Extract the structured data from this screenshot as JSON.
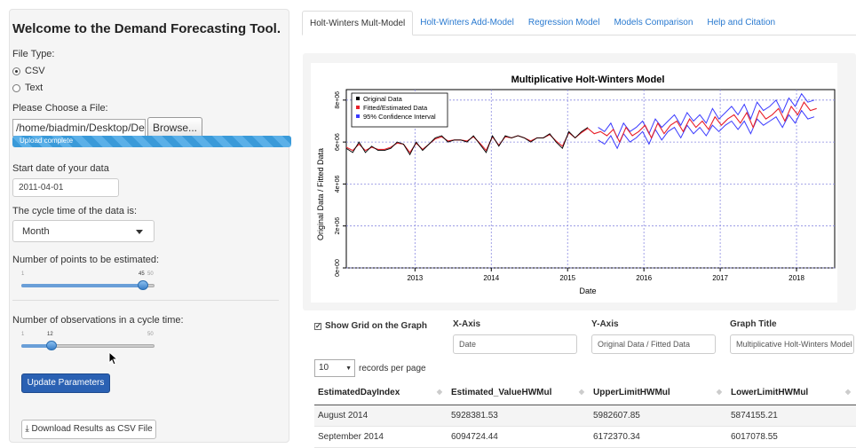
{
  "sidebar": {
    "title": "Welcome to the Demand Forecasting Tool.",
    "file_type_label": "File Type:",
    "file_type_options": [
      "CSV",
      "Text"
    ],
    "file_type_selected": "CSV",
    "choose_file_label": "Please Choose a File:",
    "file_path": "/home/biadmin/Desktop/Dem",
    "browse_label": "Browse...",
    "upload_status": "Upload complete",
    "start_date_label": "Start date of your data",
    "start_date_value": "2011-04-01",
    "cycle_label": "The cycle time of the data is:",
    "cycle_value": "Month",
    "points_label": "Number of points to be estimated:",
    "points_slider": {
      "min": "1",
      "max": "50",
      "value": "45"
    },
    "obs_label": "Number of observations in a cycle time:",
    "obs_slider": {
      "min": "1",
      "max": "50",
      "value": "12"
    },
    "update_label": "Update Parameters",
    "download_label": "Download Results as CSV File",
    "download_icon": "download-icon"
  },
  "tabs": [
    {
      "label": "Holt-Winters Mult-Model",
      "active": true
    },
    {
      "label": "Holt-Winters Add-Model",
      "active": false
    },
    {
      "label": "Regression Model",
      "active": false
    },
    {
      "label": "Models Comparison",
      "active": false
    },
    {
      "label": "Help and Citation",
      "active": false
    }
  ],
  "chart_data": {
    "type": "line",
    "title": "Multiplicative Holt-Winters Model",
    "xlabel": "Date",
    "ylabel": "Original Data / Fitted Data",
    "xlim": [
      2012.1,
      2018.5
    ],
    "ylim": [
      0,
      8500000
    ],
    "x_ticks": [
      "2013",
      "2014",
      "2015",
      "2016",
      "2017",
      "2018"
    ],
    "y_ticks": [
      "0e+00",
      "2e+06",
      "4e+06",
      "6e+06",
      "8e+06"
    ],
    "grid": true,
    "legend": "top-left",
    "series": [
      {
        "name": "Original Data",
        "color": "#000000",
        "x_start": 2012.1,
        "x_step": 0.0833,
        "values": [
          5700000,
          5500000,
          6000000,
          5500000,
          5800000,
          5600000,
          5600000,
          5700000,
          6000000,
          5900000,
          5400000,
          6000000,
          5600000,
          5900000,
          6200000,
          6300000,
          6000000,
          6100000,
          6100000,
          6000000,
          6300000,
          5900000,
          5500000,
          6300000,
          5800000,
          6300000,
          6200000,
          6300000,
          6200000,
          6000000,
          6200000,
          6200000,
          6400000,
          6000000,
          5700000,
          6500000,
          6200000,
          6500000,
          6700000
        ]
      },
      {
        "name": "Fitted/Estimated Data",
        "color": "#e8202a",
        "x_start": 2012.1,
        "x_step": 0.0833,
        "values": [
          5750000,
          5600000,
          5900000,
          5600000,
          5750000,
          5650000,
          5650000,
          5750000,
          5950000,
          5900000,
          5500000,
          5950000,
          5650000,
          5900000,
          6150000,
          6250000,
          6050000,
          6100000,
          6100000,
          6050000,
          6250000,
          5950000,
          5600000,
          6250000,
          5850000,
          6250000,
          6200000,
          6300000,
          6200000,
          6050000,
          6200000,
          6200000,
          6350000,
          6050000,
          5800000,
          6450000,
          6200000,
          6450000,
          6650000,
          6400000,
          6500000,
          6300000,
          6600000,
          6000000,
          6700000,
          6300000,
          6500000,
          6800000,
          6200000,
          6900000,
          6400000,
          6800000,
          7000000,
          6500000,
          7100000,
          6700000,
          7000000,
          6600000,
          7200000,
          6800000,
          7100000,
          7300000,
          6900000,
          7400000,
          6700000,
          7500000,
          7100000,
          7300000,
          7600000,
          7000000,
          7700000,
          7300000,
          7900000,
          7500000,
          7600000
        ]
      },
      {
        "name": "95% Confidence Interval",
        "color": "#3a3aff",
        "x_start": 2015.4,
        "x_step": 0.0833,
        "upper": [
          6700000,
          6500000,
          6900000,
          6200000,
          6900000,
          6500000,
          6700000,
          7000000,
          6400000,
          7100000,
          6700000,
          7000000,
          7300000,
          6800000,
          7400000,
          7000000,
          7300000,
          6900000,
          7600000,
          7100000,
          7400000,
          7700000,
          7300000,
          7800000,
          7100000,
          7900000,
          7500000,
          7700000,
          8000000,
          7400000,
          8100000,
          7700000,
          8300000,
          7900000,
          8000000
        ],
        "lower": [
          6100000,
          5900000,
          6300000,
          5700000,
          6400000,
          6000000,
          6200000,
          6500000,
          5900000,
          6600000,
          6100000,
          6500000,
          6700000,
          6200000,
          6800000,
          6400000,
          6700000,
          6300000,
          6800000,
          6500000,
          6800000,
          7000000,
          6600000,
          7000000,
          6400000,
          7100000,
          6800000,
          7000000,
          7200000,
          6700000,
          7300000,
          6900000,
          7500000,
          7100000,
          7200000
        ]
      }
    ]
  },
  "graph_controls": {
    "show_grid_label": "Show Grid on the Graph",
    "show_grid_checked": true,
    "xaxis_label": "X-Axis",
    "xaxis_value": "Date",
    "yaxis_label": "Y-Axis",
    "yaxis_value": "Original Data / Fitted Data",
    "title_label": "Graph Title",
    "title_value": "Multiplicative Holt-Winters Model"
  },
  "table": {
    "page_size": "10",
    "records_label": "records per page",
    "columns": [
      "EstimatedDayIndex",
      "Estimated_ValueHWMul",
      "UpperLimitHWMul",
      "LowerLimitHWMul"
    ],
    "rows": [
      [
        "August 2014",
        "5928381.53",
        "5982607.85",
        "5874155.21"
      ],
      [
        "September 2014",
        "6094724.44",
        "6172370.34",
        "6017078.55"
      ]
    ]
  }
}
